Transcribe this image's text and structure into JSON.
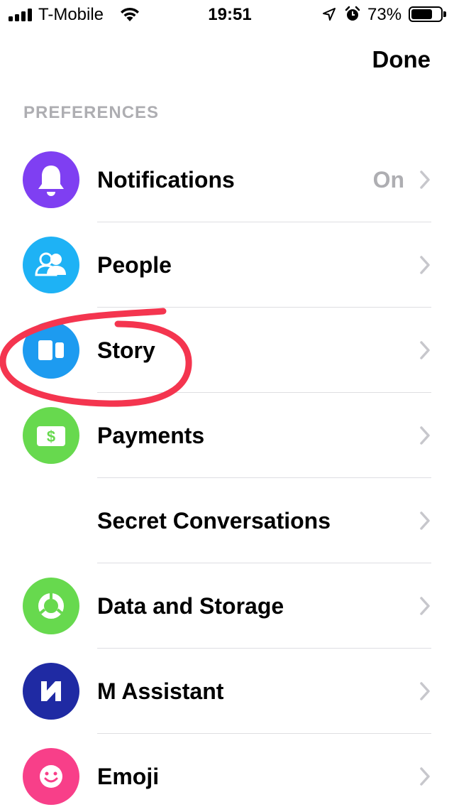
{
  "status_bar": {
    "carrier": "T-Mobile",
    "time": "19:51",
    "battery_percent_label": "73%",
    "battery_level": 0.73,
    "icons": [
      "signal-icon",
      "wifi-icon",
      "location-arrow-icon",
      "alarm-clock-icon",
      "battery-icon"
    ]
  },
  "nav": {
    "done_label": "Done"
  },
  "section": {
    "header": "PREFERENCES"
  },
  "rows": [
    {
      "label": "Notifications",
      "value": "On",
      "icon": "bell-icon",
      "icon_color": "#7f3ff2"
    },
    {
      "label": "People",
      "value": "",
      "icon": "people-icon",
      "icon_color": "#1eb2f5"
    },
    {
      "label": "Story",
      "value": "",
      "icon": "story-icon",
      "icon_color": "#1d9bf0"
    },
    {
      "label": "Payments",
      "value": "",
      "icon": "dollar-icon",
      "icon_color": "#67d94e"
    },
    {
      "label": "Secret Conversations",
      "value": "",
      "icon": "",
      "icon_color": ""
    },
    {
      "label": "Data and Storage",
      "value": "",
      "icon": "pie-chart-icon",
      "icon_color": "#67d94e"
    },
    {
      "label": "M Assistant",
      "value": "",
      "icon": "m-assistant-icon",
      "icon_color": "#1f2aa3"
    },
    {
      "label": "Emoji",
      "value": "",
      "icon": "smiley-icon",
      "icon_color": "#f83f89"
    }
  ],
  "colors": {
    "section_header": "#aeaeb2",
    "value_text": "#aeaeb2",
    "divider": "#dedee2",
    "annotation": "#f4354f"
  }
}
